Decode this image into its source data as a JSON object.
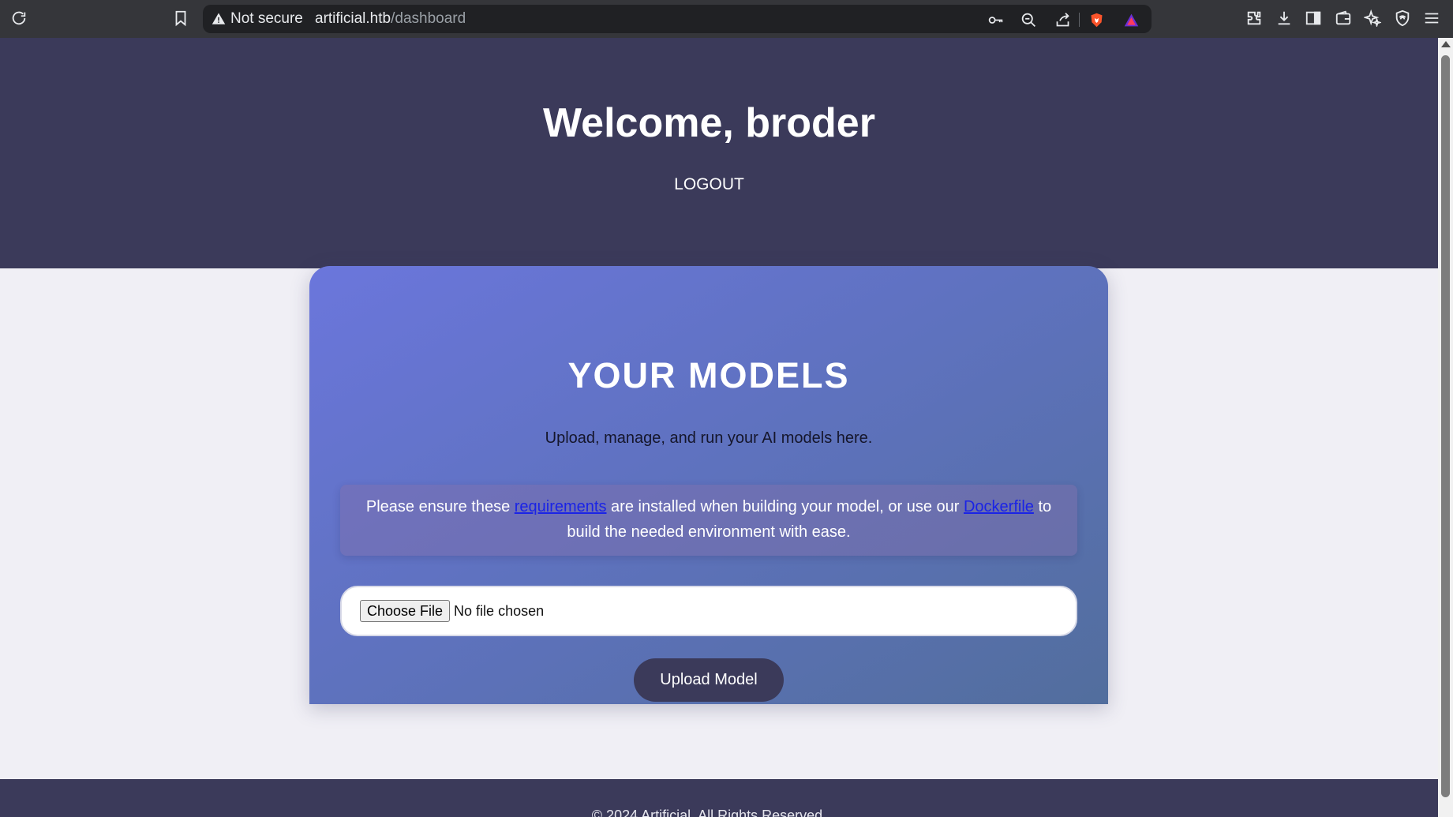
{
  "browser": {
    "security_label": "Not secure",
    "url_host": "artificial.htb",
    "url_path": "/dashboard"
  },
  "header": {
    "welcome": "Welcome, broder",
    "logout": "LOGOUT"
  },
  "card": {
    "title": "YOUR MODELS",
    "subtitle": "Upload, manage, and run your AI models here.",
    "requirements": {
      "text_before": "Please ensure these ",
      "link1": "requirements",
      "text_middle": " are installed when building your model, or use our ",
      "link2": "Dockerfile",
      "text_after": " to build the needed environment with ease."
    },
    "file_input": {
      "button_label": "Choose File",
      "status": "No file chosen"
    },
    "upload_button": "Upload Model"
  },
  "footer": {
    "text": "© 2024 Artificial. All Rights Reserved."
  },
  "colors": {
    "header_bg": "#3b3a5a",
    "link": "#1a23e6",
    "card_gradient_start": "#6b76dc",
    "card_gradient_end": "#526e9d"
  }
}
